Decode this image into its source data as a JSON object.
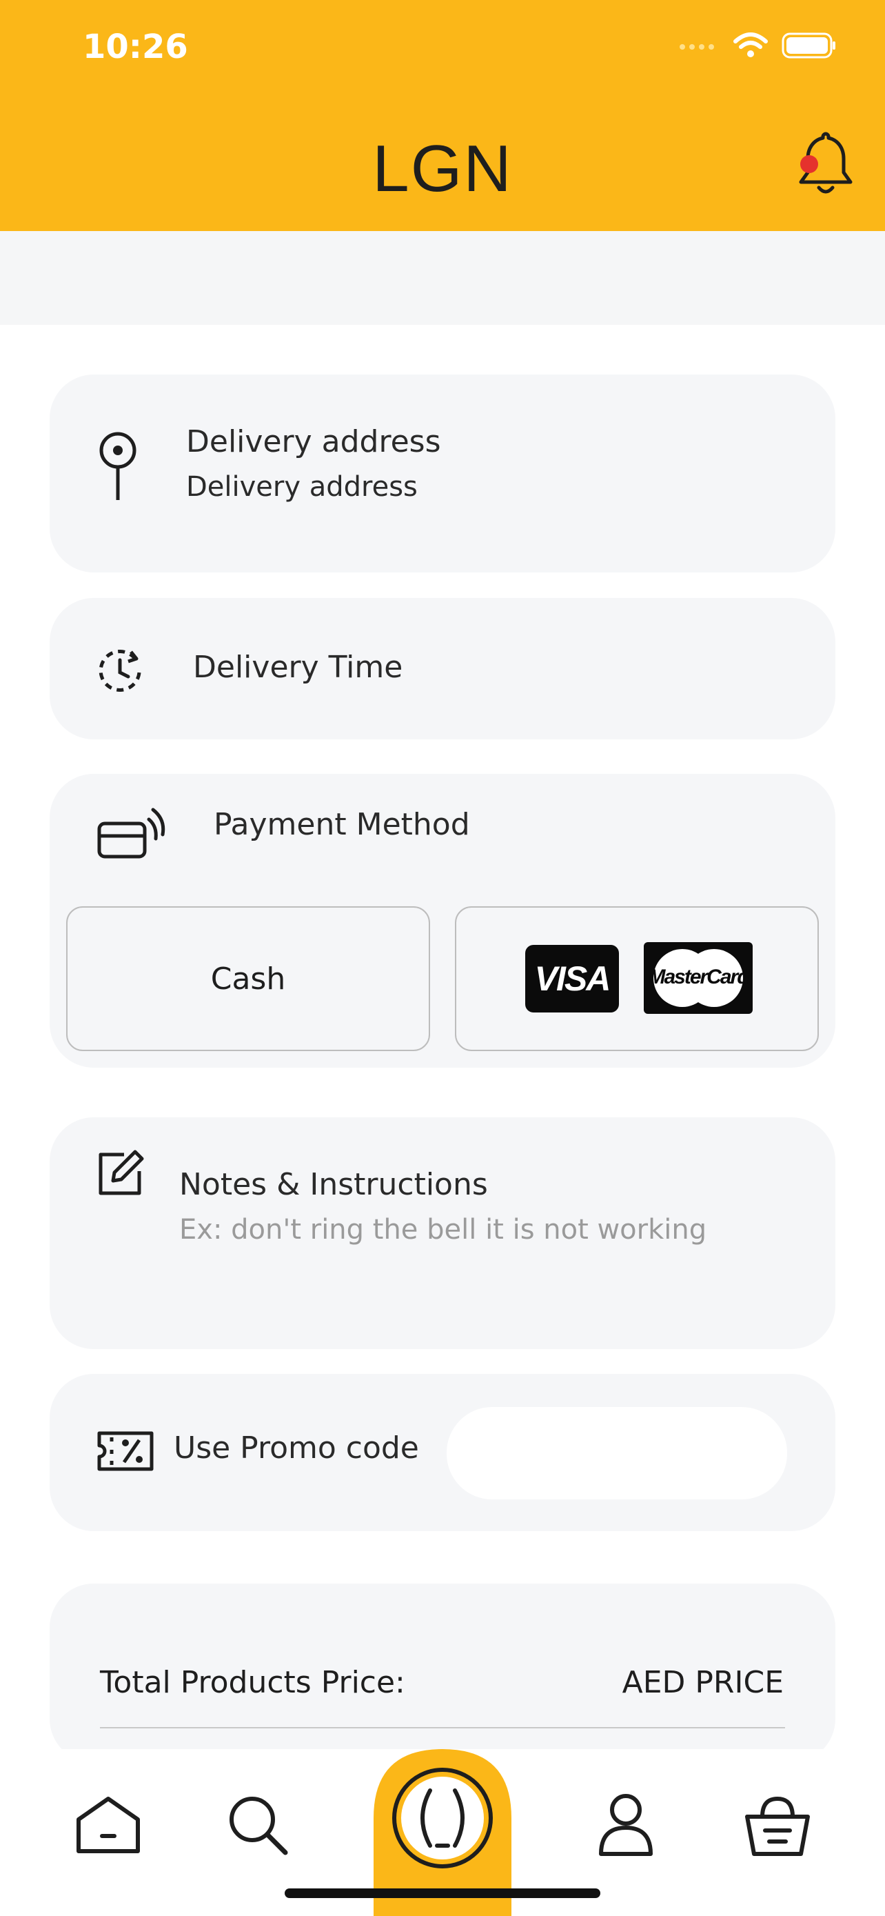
{
  "status_bar": {
    "time": "10:26"
  },
  "header": {
    "logo": "LGN"
  },
  "delivery_address": {
    "title": "Delivery address",
    "value": "Delivery address"
  },
  "delivery_time": {
    "title": "Delivery Time"
  },
  "payment": {
    "title": "Payment Method",
    "cash_label": "Cash",
    "card_logos": [
      "VISA",
      "MasterCard"
    ]
  },
  "notes": {
    "title": "Notes & Instructions",
    "placeholder": "Ex: don't ring the bell it is not working"
  },
  "promo": {
    "label": "Use Promo code",
    "value": ""
  },
  "summary": {
    "total_label": "Total Products Price:",
    "total_value": "AED PRICE"
  },
  "colors": {
    "accent": "#FBB718",
    "card_bg": "#f5f6f8",
    "notification_dot": "#e5322d"
  },
  "bottom_nav": {
    "icons": [
      "home-icon",
      "search-icon",
      "center-icon",
      "profile-icon",
      "cart-icon"
    ]
  }
}
